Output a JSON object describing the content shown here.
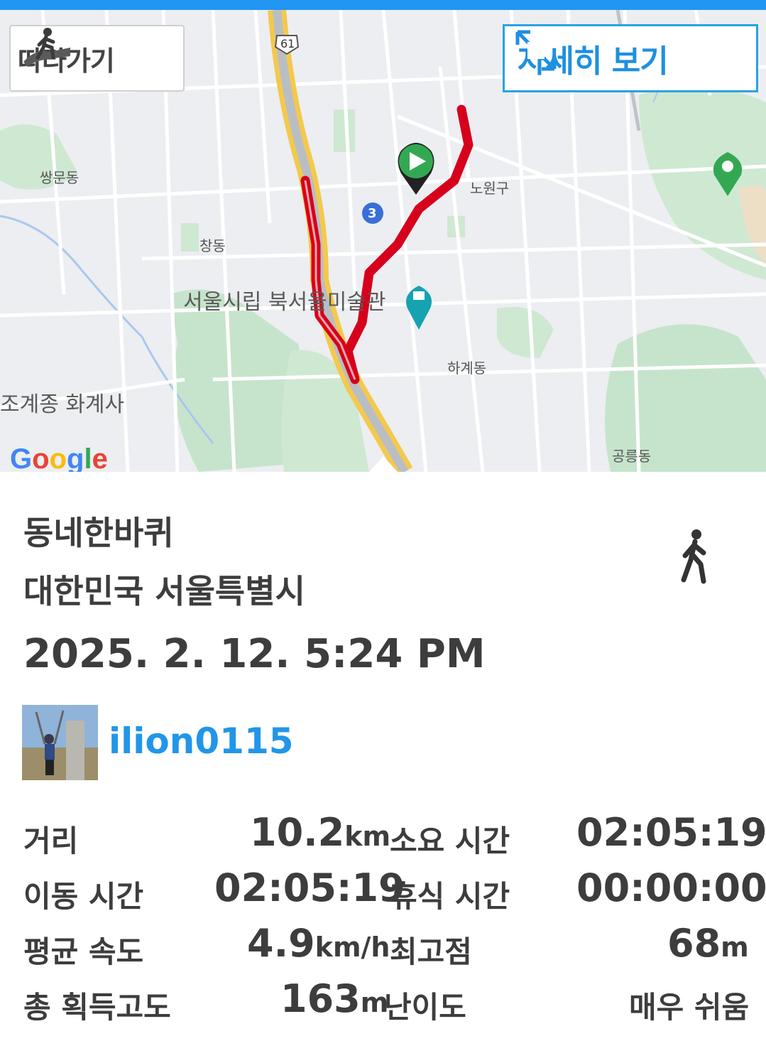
{
  "map": {
    "follow_label": "따라가기",
    "detail_label": "자세히 보기",
    "road_shield": "61",
    "marker_number": "3",
    "labels": {
      "ssangmun": "쌍문동",
      "nowon": "노원구",
      "chang": "창동",
      "museum": "서울시립 북서울미술관",
      "hagye": "하계동",
      "temple": "조계종 화계사",
      "gongneung": "공릉동",
      "google": "Google"
    }
  },
  "route": {
    "name": "동네한바퀴",
    "location": "대한민국 서울특별시",
    "datetime": "2025. 2. 12. 5:24 PM",
    "activity_icon": "walking-person-icon"
  },
  "user": {
    "name": "ilion0115"
  },
  "stats": {
    "distance_label": "거리",
    "distance_value": "10.2",
    "distance_unit": "km",
    "duration_label": "소요 시간",
    "duration_value": "02:05:19",
    "moving_label": "이동 시간",
    "moving_value": "02:05:19",
    "rest_label": "휴식 시간",
    "rest_value": "00:00:00",
    "avg_speed_label": "평균 속도",
    "avg_speed_value": "4.9",
    "avg_speed_unit": "km/h",
    "max_elev_label": "최고점",
    "max_elev_value": "68",
    "max_elev_unit": "m",
    "gain_label": "총 획득고도",
    "gain_value": "163",
    "gain_unit": "m",
    "difficulty_label": "난이도",
    "difficulty_value": "매우 쉬움"
  },
  "colors": {
    "accent": "#2196f3",
    "route": "#d6001c",
    "text": "#3d3d3d"
  }
}
